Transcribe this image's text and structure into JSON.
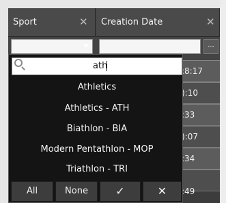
{
  "grid": {
    "columns": [
      {
        "label": "Sport",
        "close": "✕"
      },
      {
        "label": "Creation Date",
        "close": "✕"
      }
    ],
    "date_filter_button": "...",
    "visible_times": [
      ":8:17",
      "):10",
      ":33",
      "):07",
      ":34",
      ":49"
    ]
  },
  "popup": {
    "search_value": "ath",
    "options": [
      "Athletics",
      "Athletics - ATH",
      "Biathlon - BIA",
      "Modern Pentathlon - MOP",
      "Triathlon - TRI"
    ],
    "buttons": {
      "all": "All",
      "none": "None",
      "apply": "✓",
      "cancel": "✕"
    }
  },
  "icons": {
    "search": "magnifier-icon",
    "dropdown": "chevron-down-icon"
  }
}
